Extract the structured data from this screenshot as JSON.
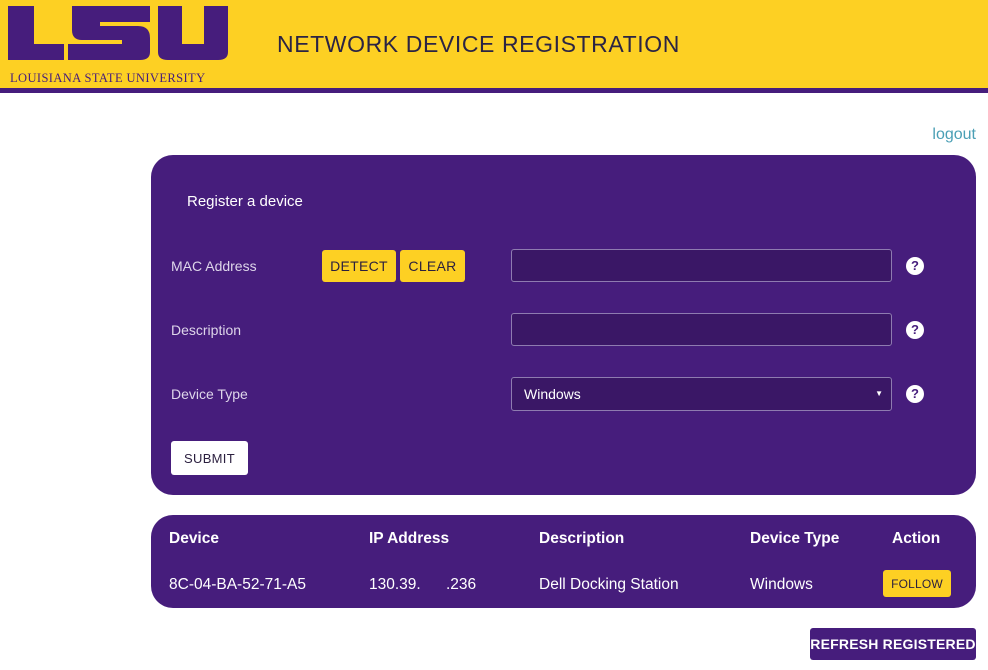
{
  "header": {
    "logo_text": "LSU",
    "logo_subtitle": "LOUISIANA STATE UNIVERSITY",
    "title": "NETWORK DEVICE REGISTRATION"
  },
  "nav": {
    "logout_label": "logout"
  },
  "register_form": {
    "title": "Register a device",
    "mac_label": "MAC Address",
    "detect_label": "DETECT",
    "clear_label": "CLEAR",
    "mac_value": "",
    "description_label": "Description",
    "description_value": "",
    "device_type_label": "Device Type",
    "device_type_selected": "Windows",
    "help_glyph": "?",
    "submit_label": "SUBMIT"
  },
  "devices_table": {
    "headers": [
      "Device",
      "IP Address",
      "Description",
      "Device Type",
      "Action"
    ],
    "rows": [
      {
        "device": "8C-04-BA-52-71-A5",
        "ip_prefix": "130.39.",
        "ip_suffix": ".236",
        "description": "Dell Docking Station",
        "device_type": "Windows",
        "action_label": "FOLLOW"
      }
    ]
  },
  "refresh_label": "REFRESH REGISTERED",
  "colors": {
    "brand_purple": "#461D7C",
    "brand_gold": "#FDD023",
    "link": "#4a9fb5"
  },
  "icons": [
    "help-icon",
    "dropdown-caret-icon"
  ]
}
